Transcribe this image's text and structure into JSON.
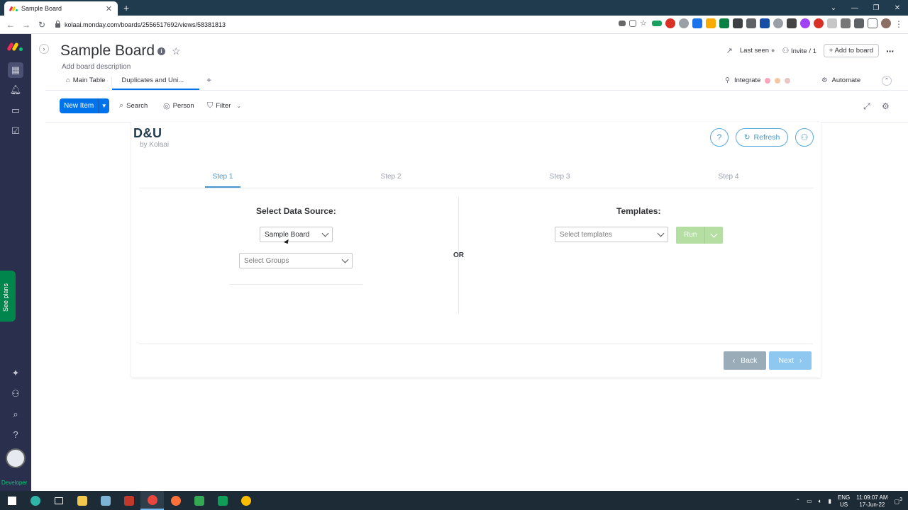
{
  "browser": {
    "tab_title": "Sample Board",
    "url": "kolaai.monday.com/boards/2556517692/views/58381813"
  },
  "rail": {
    "see_plans": "See plans",
    "developer": "Developer"
  },
  "board": {
    "title": "Sample Board",
    "description": "Add board description",
    "last_seen": "Last seen",
    "invite": "Invite / 1",
    "add_to_board": "Add to board"
  },
  "views": [
    {
      "label": "Main Table"
    },
    {
      "label": "Duplicates and Uni..."
    }
  ],
  "integrations": {
    "integrate": "Integrate",
    "automate": "Automate"
  },
  "toolbar": {
    "new_item": "New Item",
    "search": "Search",
    "person": "Person",
    "filter": "Filter"
  },
  "app": {
    "logo": "D&U",
    "logo_sub": "by Kolaai",
    "refresh": "Refresh",
    "steps": [
      {
        "label": "Step 1",
        "active": true
      },
      {
        "label": "Step 2",
        "active": false
      },
      {
        "label": "Step 3",
        "active": false
      },
      {
        "label": "Step 4",
        "active": false
      }
    ],
    "data_source_title": "Select Data Source:",
    "board_select_value": "Sample Board",
    "groups_placeholder": "Select Groups",
    "or_label": "OR",
    "templates_title": "Templates:",
    "templates_placeholder": "Select templates",
    "run": "Run",
    "back": "Back",
    "next": "Next"
  },
  "taskbar": {
    "lang": "ENG",
    "region": "US",
    "time": "11:09:07 AM",
    "date": "17-Jun-22",
    "notifications": "3"
  },
  "colors": {
    "rail": "#292f4c",
    "primary": "#0073ea",
    "app_accent": "#4896cf",
    "run_disabled": "#b5dfa2",
    "next_disabled": "#8ec7ef",
    "back_disabled": "#9aacb8"
  }
}
